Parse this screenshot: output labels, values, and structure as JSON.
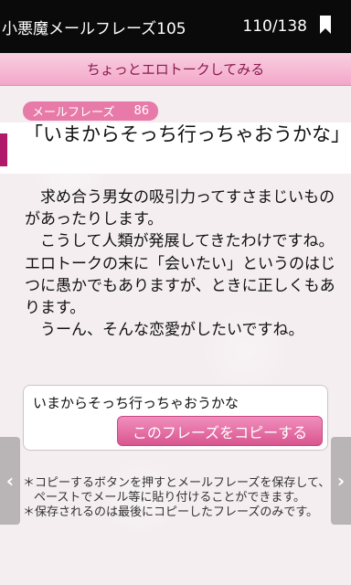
{
  "titlebar": {
    "app_title": "小悪魔メールフレーズ105",
    "page_count": "110/138",
    "bookmark_icon": "bookmark-icon"
  },
  "category": {
    "label": "ちょっとエロトークしてみる"
  },
  "badge": {
    "label": "メールフレーズ",
    "number": "86"
  },
  "phrase": {
    "title": "「いまからそっち行っちゃおうかな」"
  },
  "body": {
    "paragraphs": [
      "求め合う男女の吸引力ってすさまじいものがあったりします。",
      "こうして人類が発展してきたわけですね。エロトークの末に「会いたい」というのはじつに愚かでもありますが、ときに正しくもあります。",
      "うーん、そんな恋愛がしたいですね。"
    ]
  },
  "copy_box": {
    "text": "いまからそっち行っちゃおうかな",
    "button_label": "このフレーズをコピーする"
  },
  "notes": [
    "＊コピーするボタンを押すとメールフレーズを保存して、ペーストでメール等に貼り付けることができます。",
    "＊保存されるのは最後にコピーしたフレーズのみです。"
  ],
  "nav": {
    "prev_icon": "chevron-left-icon",
    "next_icon": "chevron-right-icon",
    "prev_glyph": "‹",
    "next_glyph": "›"
  },
  "colors": {
    "accent": "#e77aa8",
    "category_text": "#8a1950",
    "marker": "#b0186a"
  }
}
